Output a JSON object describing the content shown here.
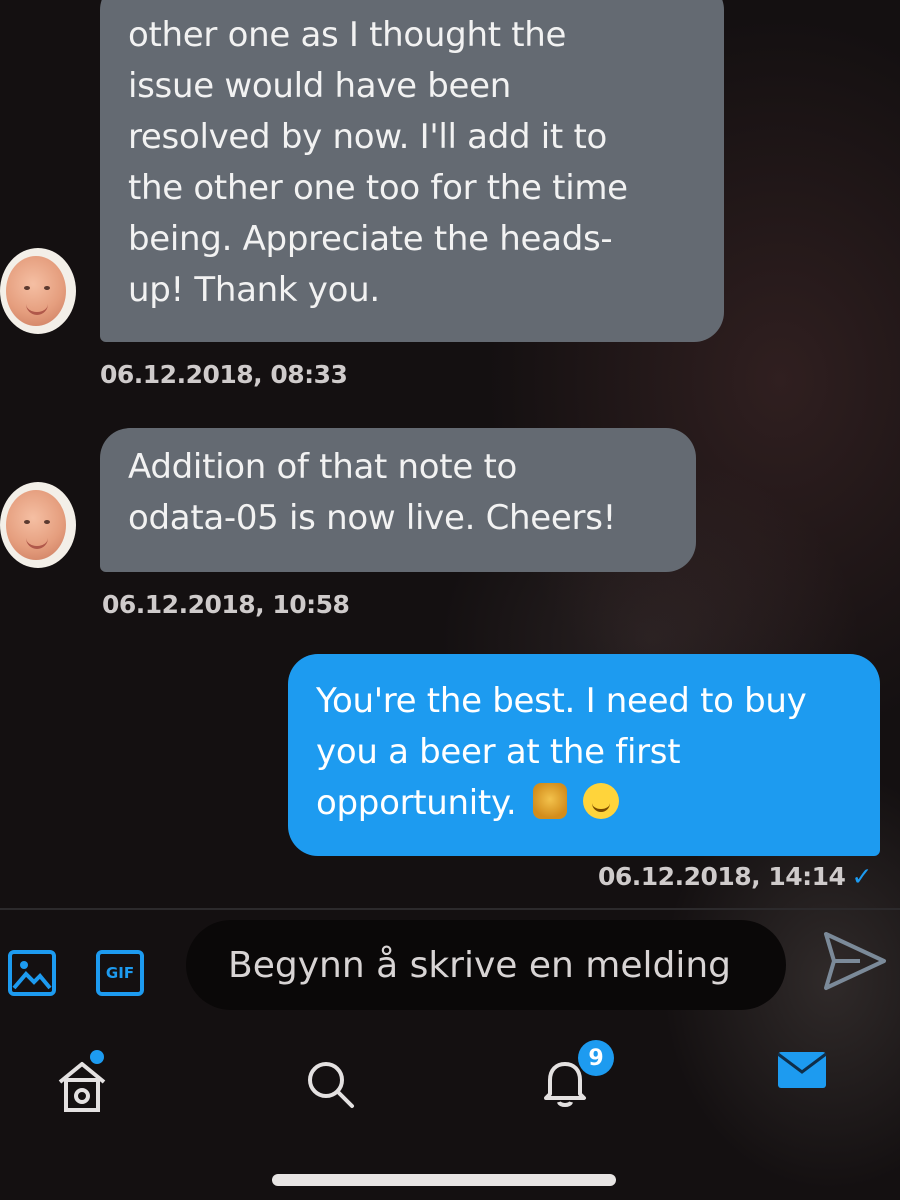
{
  "conversation": {
    "messages": [
      {
        "direction": "incoming",
        "lines": [
          "other one as I thought the",
          "issue would have been",
          "resolved by now. I'll add it to",
          "the other one too for the time",
          "being. Appreciate the heads-",
          "up! Thank you."
        ],
        "timestamp": "06.12.2018, 08:33"
      },
      {
        "direction": "incoming",
        "lines": [
          "Addition of that note to",
          "odata-05 is now live. Cheers!"
        ],
        "timestamp": "06.12.2018, 10:58"
      },
      {
        "direction": "outgoing",
        "lines": [
          "You're the best. I need to buy",
          "you a beer at the first",
          "opportunity."
        ],
        "emojis": [
          "beer-mugs-emoji",
          "slightly-smiling-face-emoji"
        ],
        "timestamp": "06.12.2018, 14:14",
        "status_icon": "read-check-icon"
      }
    ]
  },
  "composer": {
    "media_icon": "image-icon",
    "gif_label": "GIF",
    "placeholder": "Begynn å skrive en melding",
    "send_icon": "send-icon"
  },
  "bottom_nav": {
    "items": [
      {
        "icon": "home-icon",
        "has_dot": true
      },
      {
        "icon": "search-icon"
      },
      {
        "icon": "bell-icon",
        "badge": "9"
      },
      {
        "icon": "mail-icon",
        "active": true
      }
    ]
  },
  "colors": {
    "accent": "#1d9bf0",
    "incoming_bubble": "#646a72",
    "background": "#141011"
  }
}
